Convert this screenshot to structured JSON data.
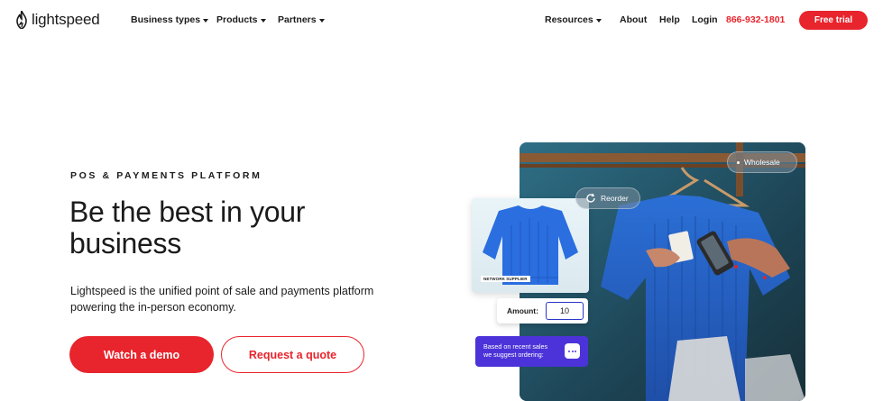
{
  "brand": {
    "name": "lightspeed",
    "accent": "#e8242c",
    "purple": "#4b33d9"
  },
  "nav": {
    "business_types": "Business types",
    "products": "Products",
    "partners": "Partners",
    "resources": "Resources",
    "about": "About",
    "help": "Help",
    "login": "Login",
    "phone": "866-932-1801",
    "free_trial": "Free trial"
  },
  "hero": {
    "eyebrow": "POS & PAYMENTS PLATFORM",
    "headline": "Be the best in your business",
    "subtext": "Lightspeed is the unified point of sale and payments platform powering the in-person economy.",
    "watch_demo": "Watch a demo",
    "request_quote": "Request a quote"
  },
  "overlay": {
    "reorder": "Reorder",
    "wholesale": "Wholesale",
    "supplier_tag": "NETWORK SUPPLIER",
    "amount_label": "Amount:",
    "amount_value": "10",
    "suggest_line1": "Based on recent sales",
    "suggest_line2": "we suggest ordering:"
  },
  "icons": {
    "logo": "flame-icon",
    "reorder": "refresh-icon",
    "chat": "chat-dots-icon",
    "caret": "chevron-down-icon"
  }
}
